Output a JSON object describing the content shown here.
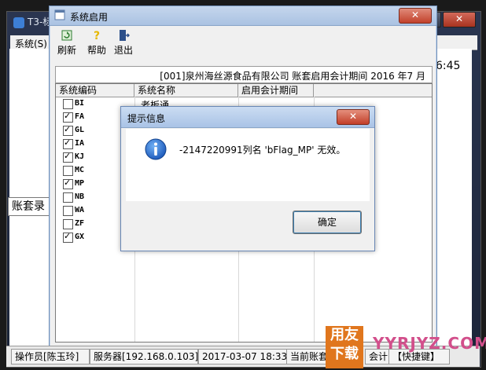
{
  "main_window": {
    "title": "T3-标",
    "menu_first": "系统(S)",
    "clock": "6:45",
    "account_label": "账套录"
  },
  "sys_window": {
    "title": "系统启用",
    "close": "✕",
    "toolbar": {
      "refresh": "刷新",
      "help": "帮助",
      "exit": "退出"
    },
    "info": "[001]泉州海丝源食品有限公司  账套启用会计期间 2016 年7 月",
    "columns": [
      "系统编码",
      "系统名称",
      "启用会计期间"
    ],
    "rows": [
      {
        "code": "BI",
        "checked": false,
        "name": "老板通"
      },
      {
        "code": "FA",
        "checked": true,
        "name": ""
      },
      {
        "code": "GL",
        "checked": true,
        "name": ""
      },
      {
        "code": "IA",
        "checked": true,
        "name": ""
      },
      {
        "code": "KJ",
        "checked": true,
        "name": ""
      },
      {
        "code": "MC",
        "checked": false,
        "name": ""
      },
      {
        "code": "MP",
        "checked": true,
        "name": ""
      },
      {
        "code": "NB",
        "checked": false,
        "name": ""
      },
      {
        "code": "WA",
        "checked": false,
        "name": ""
      },
      {
        "code": "ZF",
        "checked": false,
        "name": ""
      },
      {
        "code": "GX",
        "checked": true,
        "name": ""
      }
    ]
  },
  "dialog": {
    "title": "提示信息",
    "close": "✕",
    "message": "-2147220991列名 'bFlag_MP' 无效。",
    "ok": "确定",
    "icon": "info-icon"
  },
  "statusbar": {
    "operator": "操作员[陈玉玲]",
    "server": "服务器[192.168.0.103]",
    "datetime": "2017-03-07 18:33",
    "current_account": "当前账套:",
    "extra": "会计",
    "shortcut": "【快捷键】"
  },
  "watermark": {
    "badge_top": "用友",
    "badge_bottom": "下载",
    "site": "YYRJYZ.COM"
  },
  "colors": {
    "accent": "#3c7fb1",
    "title_bar": "#aac2e2",
    "watermark_orange": "#e0761d",
    "watermark_pink": "#d24f8b"
  }
}
